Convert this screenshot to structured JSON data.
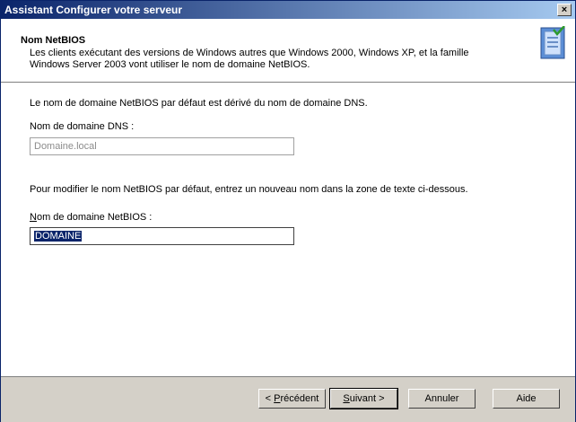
{
  "window": {
    "title": "Assistant Configurer votre serveur",
    "close_glyph": "×"
  },
  "header": {
    "title": "Nom NetBIOS",
    "description": "Les clients exécutant des versions de Windows autres que Windows 2000, Windows XP, et la famille Windows Server 2003 vont utiliser le nom de domaine NetBIOS.",
    "icon": "server-wizard-icon"
  },
  "body": {
    "intro": "Le nom de domaine NetBIOS par défaut est dérivé du nom de domaine DNS.",
    "dns_label": "Nom de domaine DNS :",
    "dns_value": "Domaine.local",
    "modify_text": "Pour modifier le nom NetBIOS par défaut, entrez un nouveau nom dans la zone de texte ci-dessous.",
    "netbios_label_first": "N",
    "netbios_label_rest": "om de domaine NetBIOS :",
    "netbios_value": "DOMAINE"
  },
  "buttons": {
    "back_prefix": "< ",
    "back_accel": "P",
    "back_rest": "récédent",
    "next_accel": "S",
    "next_rest": "uivant >",
    "cancel": "Annuler",
    "help": "Aide"
  },
  "colors": {
    "titlebar_start": "#0a246a",
    "titlebar_end": "#a6caf0",
    "selection": "#0a246a"
  }
}
